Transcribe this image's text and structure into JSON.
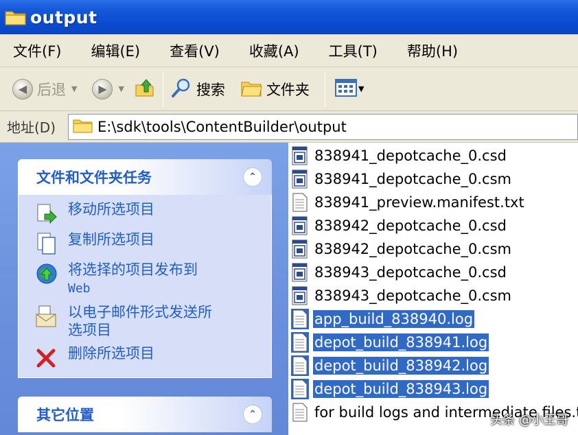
{
  "window": {
    "title": "output"
  },
  "menu": {
    "items": [
      "文件(F)",
      "编辑(E)",
      "查看(V)",
      "收藏(A)",
      "工具(T)",
      "帮助(H)"
    ]
  },
  "toolbar": {
    "back_label": "后退",
    "search_label": "搜索",
    "folders_label": "文件夹"
  },
  "address": {
    "label": "地址(D)",
    "path": "E:\\sdk\\tools\\ContentBuilder\\output"
  },
  "task_panel": {
    "title": "文件和文件夹任务",
    "tasks": [
      {
        "label": "移动所选项目",
        "icon": "move-icon"
      },
      {
        "label": "复制所选项目",
        "icon": "copy-icon"
      },
      {
        "label": "将选择的项目发布到",
        "label2": "Web",
        "icon": "publish-web-icon"
      },
      {
        "label": "以电子邮件形式发送所",
        "label2": "选项目",
        "icon": "email-icon"
      },
      {
        "label": "删除所选项目",
        "icon": "delete-icon"
      }
    ]
  },
  "other_places_panel": {
    "title": "其它位置"
  },
  "files": [
    {
      "name": "838941_depotcache_0.csd",
      "type": "data",
      "selected": false
    },
    {
      "name": "838941_depotcache_0.csm",
      "type": "data",
      "selected": false
    },
    {
      "name": "838941_preview.manifest.txt",
      "type": "text",
      "selected": false
    },
    {
      "name": "838942_depotcache_0.csd",
      "type": "data",
      "selected": false
    },
    {
      "name": "838942_depotcache_0.csm",
      "type": "data",
      "selected": false
    },
    {
      "name": "838943_depotcache_0.csd",
      "type": "data",
      "selected": false
    },
    {
      "name": "838943_depotcache_0.csm",
      "type": "data",
      "selected": false
    },
    {
      "name": "app_build_838940.log",
      "type": "log",
      "selected": true
    },
    {
      "name": "depot_build_838941.log",
      "type": "log",
      "selected": true
    },
    {
      "name": "depot_build_838942.log",
      "type": "log",
      "selected": true
    },
    {
      "name": "depot_build_838943.log",
      "type": "log",
      "selected": true
    },
    {
      "name": "for build logs and intermediate files.txt",
      "type": "text",
      "selected": false
    }
  ],
  "watermark": "头条 @小王哥",
  "colors": {
    "selection": "#316ac5",
    "task_link": "#215dc6",
    "title_bar": "#0a4bd0"
  }
}
